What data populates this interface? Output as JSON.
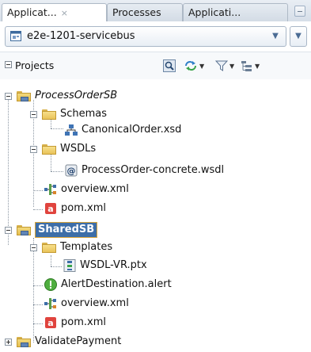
{
  "tabs": [
    {
      "label": "Applicat...",
      "close": "×",
      "active": true
    },
    {
      "label": "Processes",
      "active": false
    },
    {
      "label": "Applicati...",
      "active": false
    }
  ],
  "app_selector": {
    "value": "e2e-1201-servicebus"
  },
  "projects_header": {
    "title": "Projects"
  },
  "toolbar_icons": [
    "search-icon",
    "sync-icon",
    "filter-icon",
    "hierarchy-icon"
  ],
  "tree": {
    "process_order": {
      "label": "ProcessOrderSB"
    },
    "schemas": {
      "label": "Schemas"
    },
    "canonical_xsd": {
      "label": "CanonicalOrder.xsd"
    },
    "wsdls": {
      "label": "WSDLs"
    },
    "process_wsdl": {
      "label": "ProcessOrder-concrete.wsdl"
    },
    "overview1": {
      "label": "overview.xml"
    },
    "pom1": {
      "label": "pom.xml"
    },
    "shared": {
      "label": "SharedSB"
    },
    "templates": {
      "label": "Templates"
    },
    "wsdl_ptx": {
      "label": "WSDL-VR.ptx"
    },
    "alert": {
      "label": "AlertDestination.alert"
    },
    "overview2": {
      "label": "overview.xml"
    },
    "pom2": {
      "label": "pom.xml"
    },
    "validate": {
      "label": "ValidatePayment"
    }
  },
  "colors": {
    "selection": "#3d6ea8",
    "selection_border": "#d9a43a",
    "tab_bar": "#d6dee8"
  }
}
